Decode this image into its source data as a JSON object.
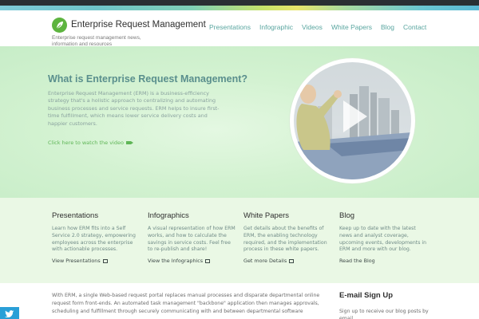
{
  "header": {
    "brand": "Enterprise Request Management",
    "tagline": "Enterprise request management news, information and resources",
    "nav": [
      "Presentations",
      "Infographic",
      "Videos",
      "White Papers",
      "Blog",
      "Contact"
    ]
  },
  "hero": {
    "title": "What is Enterprise Request Management?",
    "body": "Enterprise Request Management (ERM) is a business-efficiency strategy that's a holistic approach to centralizing and automating business processes and service requests. ERM helps to insure first-time fulfillment, which means lower service delivery costs and happier customers.",
    "link": "Click here to watch the video"
  },
  "columns": [
    {
      "title": "Presentations",
      "text": "Learn how ERM fits into a Self Service 2.0 strategy, empowering employees across the enterprise with actionable processes.",
      "link": "View Presentations"
    },
    {
      "title": "Infographics",
      "text": "A visual representation of how ERM works, and how to calculate the savings in service costs. Feel free to re-publish and share!",
      "link": "View the Infographics"
    },
    {
      "title": "White Papers",
      "text": "Get details about the benefits of ERM, the enabling technology required, and the implementation process in these white papers.",
      "link": "Get more Details"
    },
    {
      "title": "Blog",
      "text": "Keep up to date with the latest news and analyst coverage, upcoming events, developments in ERM and more with our blog.",
      "link": "Read the Blog"
    }
  ],
  "bottom": {
    "text": "With ERM, a single Web-based request portal replaces manual processes and disparate departmental online request form front-ends. An automated task management \"backbone\" application then manages approvals, scheduling and fulfillment through securely communicating with and between departmental software",
    "email_title": "E-mail Sign Up",
    "email_text": "Sign up to receive our blog posts by email."
  },
  "colors": {
    "accent": "#5fb657",
    "nav": "#5aa6a0",
    "hero_bg": "#d3f2d1",
    "twitter": "#2a9fd7"
  }
}
